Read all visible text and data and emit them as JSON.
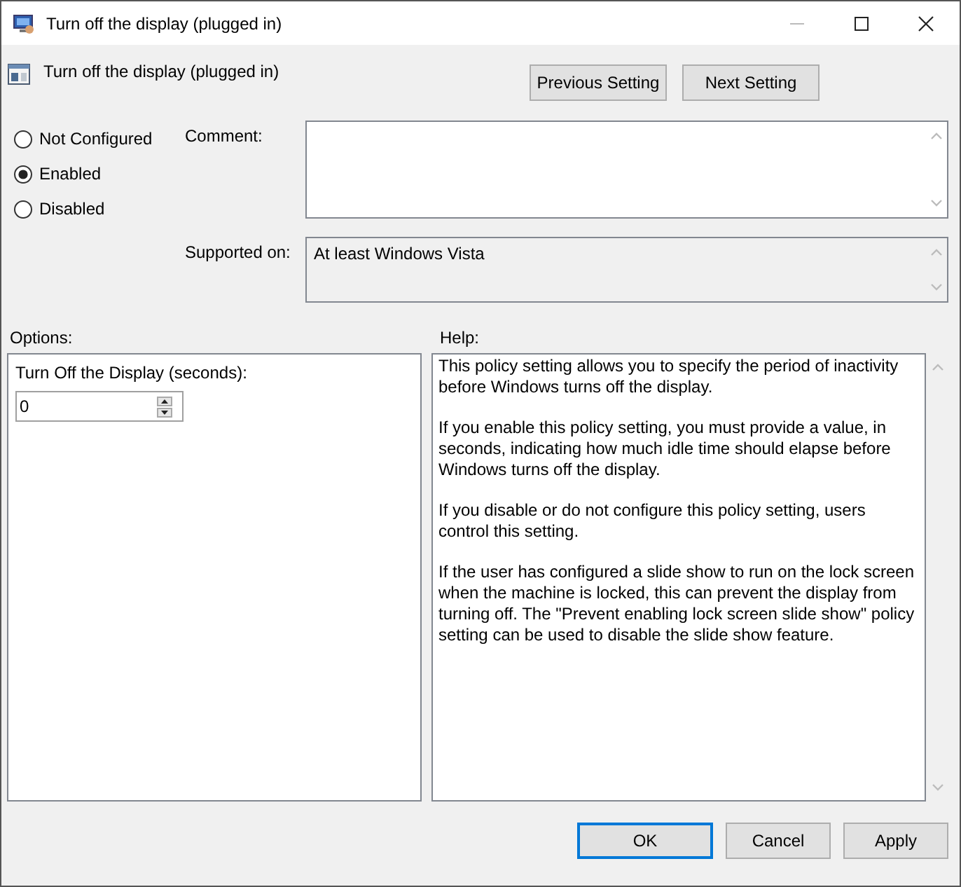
{
  "window": {
    "title": "Turn off the display (plugged in)"
  },
  "header": {
    "policy_name": "Turn off the display (plugged in)",
    "buttons": [
      "Previous Setting",
      "Next Setting"
    ]
  },
  "state_options": [
    {
      "label": "Not Configured",
      "selected": false
    },
    {
      "label": "Enabled",
      "selected": true
    },
    {
      "label": "Disabled",
      "selected": false
    }
  ],
  "comment": {
    "label": "Comment:"
  },
  "supported_on": {
    "label": "Supported on:",
    "value": "At least Windows Vista"
  },
  "options": {
    "label": "Options:",
    "field_label": "Turn Off the Display (seconds):",
    "value": "0"
  },
  "help": {
    "label": "Help:",
    "paragraphs": [
      "This policy setting allows you to specify the period of inactivity before Windows turns off the display.",
      "If you enable this policy setting, you must provide a value, in seconds, indicating how much idle time should elapse before Windows turns off the display.",
      "If you disable or do not configure this policy setting, users control this setting.",
      "If the user has configured a slide show to run on the lock screen when the machine is locked, this can prevent the display from turning off.  The \"Prevent enabling lock screen slide show\" policy setting can be used to disable the slide show feature."
    ]
  },
  "buttons": [
    {
      "label": "OK",
      "selected": true
    },
    {
      "label": "Cancel",
      "selected": false
    },
    {
      "label": "Apply",
      "selected": false
    }
  ]
}
